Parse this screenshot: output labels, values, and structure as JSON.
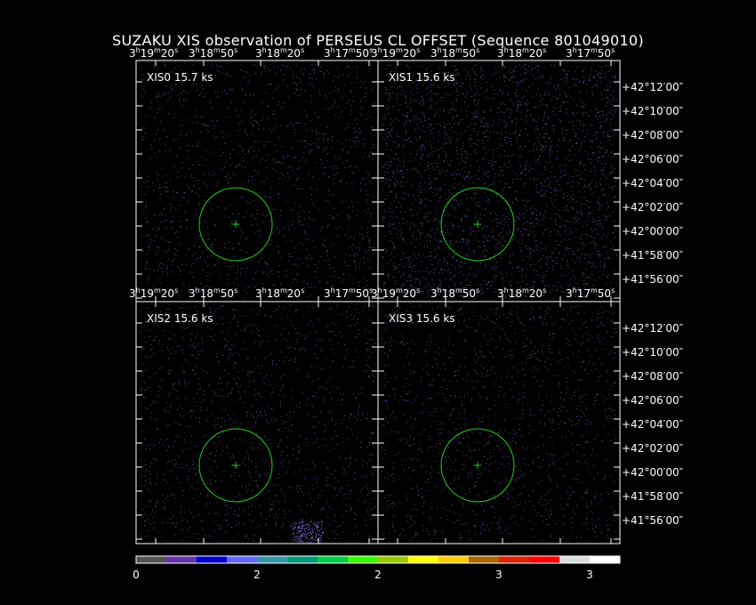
{
  "title": "SUZAKU XIS observation of PERSEUS CL OFFSET  (Sequence 801049010)",
  "panels": [
    {
      "label": "XIS0  15.7 ks"
    },
    {
      "label": "XIS1  15.6 ks"
    },
    {
      "label": "XIS2  15.6 ks"
    },
    {
      "label": "XIS3  15.6 ks"
    }
  ],
  "ra_ticks": [
    {
      "h": "3",
      "m": "19",
      "s": "20"
    },
    {
      "h": "3",
      "m": "18",
      "s": "50"
    },
    {
      "h": "3",
      "m": "18",
      "s": "20"
    },
    {
      "h": "3",
      "m": "17",
      "s": "50"
    }
  ],
  "dec_ticks": [
    "+42°12′00″",
    "+42°10′00″",
    "+42°08′00″",
    "+42°06′00″",
    "+42°04′00″",
    "+42°02′00″",
    "+42°00′00″",
    "+41°58′00″",
    "+41°56′00″"
  ],
  "colorbar": {
    "colors": [
      "#555555",
      "#6633aa",
      "#0000cc",
      "#6666ff",
      "#3399aa",
      "#009977",
      "#00cc44",
      "#33ff00",
      "#99cc00",
      "#ffff00",
      "#ffcc00",
      "#aa6600",
      "#dd2200",
      "#ff0000",
      "#dddddd",
      "#ffffff"
    ],
    "labels": [
      "0",
      "2",
      "2",
      "3",
      "3"
    ]
  },
  "colors": {
    "region": "#22cc22",
    "events": "#7a72d8"
  }
}
